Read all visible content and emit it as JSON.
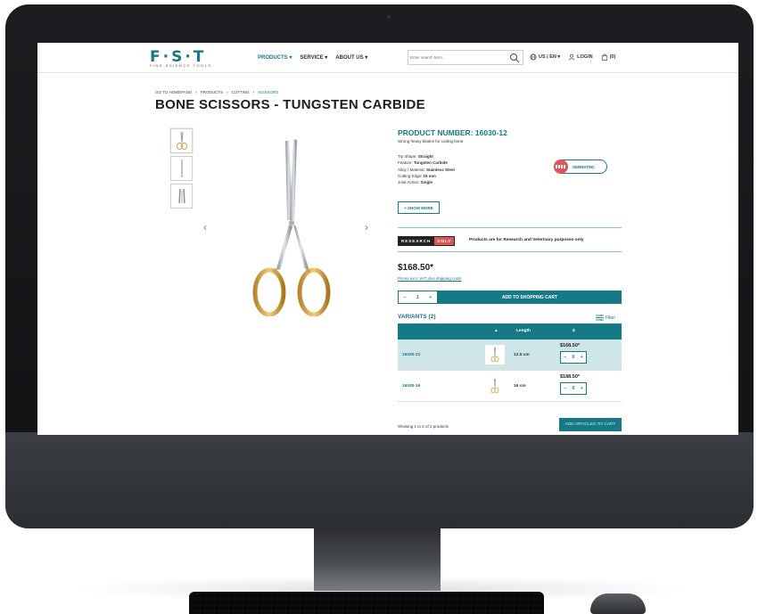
{
  "nav": {
    "logo": "F·S·T",
    "logo_sub": "FINE SCIENCE TOOLS",
    "menu": [
      "PRODUCTS ▾",
      "SERVICE ▾",
      "ABOUT US ▾"
    ],
    "search_placeholder": "Enter search term...",
    "region": "US | EN ▾",
    "login": "LOGIN",
    "cart": "(0)"
  },
  "breadcrumb": [
    "GO TO HOMEPAGE",
    "PRODUCTS",
    "CUTTING",
    "SCISSORS"
  ],
  "title": "BONE SCISSORS - TUNGSTEN CARBIDE",
  "product": {
    "number": "PRODUCT NUMBER: 16030-12",
    "description": "Strong heavy blades for cutting bone.",
    "specs": [
      {
        "label": "Tip Shape: ",
        "value": "Straight"
      },
      {
        "label": "Feature: ",
        "value": "Tungsten Carbide"
      },
      {
        "label": "Alloy / Material: ",
        "value": "Stainless Steel"
      },
      {
        "label": "Cutting Edge: ",
        "value": "15 mm"
      },
      {
        "label": "Joint Action: ",
        "value": "Single"
      }
    ],
    "badge": "SERRATED",
    "show_more": "+ SHOW MORE",
    "research_a": "RESEARCH",
    "research_b": "ONLY",
    "research_note": "Products are for Research and Veterinary purposes only",
    "price": "$168.50*",
    "price_note": "Prices excl. VAT plus shipping costs",
    "qty": "1",
    "add_to_cart": "ADD TO SHOPPING CART"
  },
  "variants": {
    "title": "VARIANTS (2)",
    "filter": "Filter",
    "headers": {
      "sort": "▲",
      "length": "Length",
      "dollar": "$"
    },
    "rows": [
      {
        "number": "16030-12",
        "length": "12.5 cm",
        "price": "$168.50*",
        "qty": "0"
      },
      {
        "number": "16030-16",
        "length": "16 cm",
        "price": "$188.50*",
        "qty": "0"
      }
    ],
    "showing": "Showing 1 to 2 of 2 products",
    "add_articles": "ADD ARTICLES TO CART"
  },
  "colors": {
    "brand": "#157a85",
    "selected_row": "#cfe6e8",
    "accent_red": "#e05555"
  }
}
